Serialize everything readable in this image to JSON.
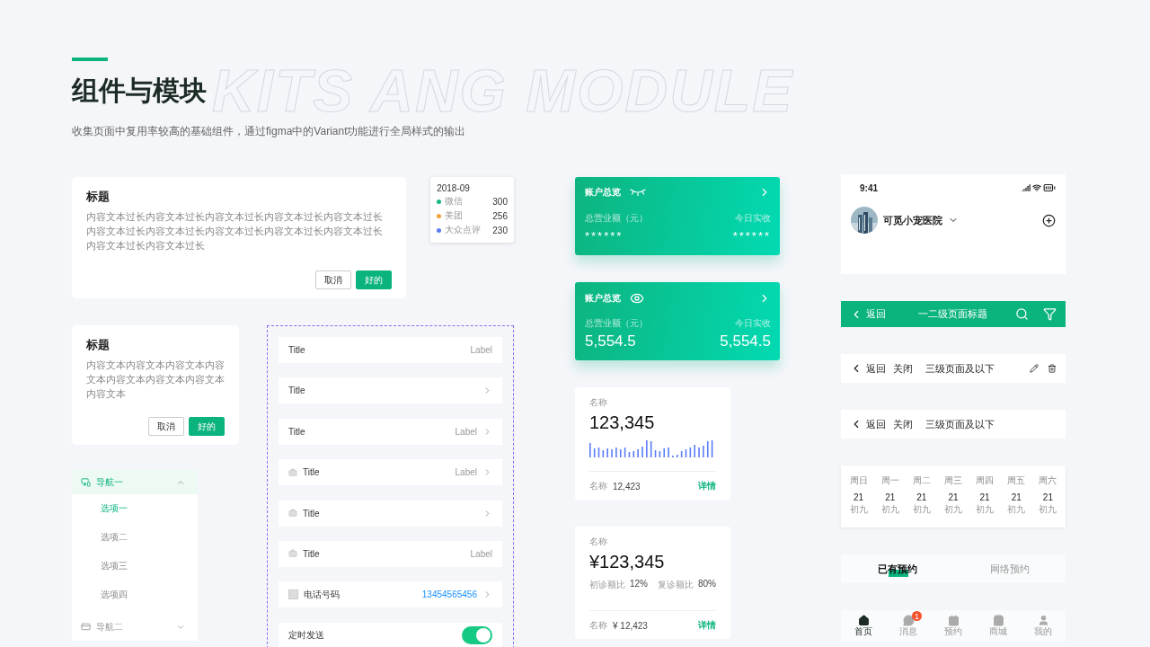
{
  "header": {
    "title": "组件与模块",
    "backdrop_text": "KITS ANG MODULE",
    "subtitle": "收集页面中复用率较高的基础组件，通过figma中的Variant功能进行全局样式的输出"
  },
  "dialogs": [
    {
      "title": "标题",
      "body": "内容文本过长内容文本过长内容文本过长内容文本过长内容文本过长内容文本过长内容文本过长内容文本过长内容文本过长内容文本过长内容文本过长内容文本过长",
      "buttons": [
        {
          "label": "取消",
          "kind": "secondary"
        },
        {
          "label": "好的",
          "kind": "primary"
        }
      ]
    },
    {
      "title": "标题",
      "body": "内容文本内容文本内容文本内容文本内容文本内容文本内容文本内容文本",
      "buttons": [
        {
          "label": "取消",
          "kind": "secondary"
        },
        {
          "label": "好的",
          "kind": "primary"
        }
      ]
    }
  ],
  "tooltip": {
    "date": "2018-09",
    "rows": [
      {
        "name": "微信",
        "value": "300",
        "color": "#12b886"
      },
      {
        "name": "美团",
        "value": "256",
        "color": "#f59f3a"
      },
      {
        "name": "大众点评",
        "value": "230",
        "color": "#5b7cf7"
      }
    ]
  },
  "nav_menu": [
    {
      "label": "导航一",
      "expanded": true,
      "items": [
        {
          "label": "选项一",
          "selected": true
        },
        {
          "label": "选项二",
          "selected": false
        },
        {
          "label": "选项三",
          "selected": false
        },
        {
          "label": "选项四",
          "selected": false
        }
      ]
    },
    {
      "label": "导航二",
      "expanded": false
    }
  ],
  "list_cells": [
    {
      "kind": "plain",
      "title": "Title",
      "label": "Label",
      "arrow": false
    },
    {
      "kind": "plain",
      "title": "Title",
      "arrow": true
    },
    {
      "kind": "plain",
      "title": "Title",
      "label": "Label",
      "arrow": true
    },
    {
      "kind": "icon",
      "title": "Title",
      "label": "Label",
      "arrow": true
    },
    {
      "kind": "icon",
      "title": "Title",
      "arrow": true
    },
    {
      "kind": "icon",
      "title": "Title",
      "label": "Label",
      "arrow": false
    },
    {
      "kind": "phone",
      "title": "电话号码",
      "value": "13454565456",
      "arrow": true
    },
    {
      "kind": "switch",
      "title": "定时发送",
      "on": true
    }
  ],
  "account_cards": [
    {
      "title": "账户总览",
      "hidden": true,
      "left_label": "总营业额（元）",
      "left_value": "******",
      "right_label": "今日实收",
      "right_value": "******"
    },
    {
      "title": "账户总览",
      "hidden": false,
      "left_label": "总营业额（元）",
      "left_value": "5,554.5",
      "right_label": "今日实收",
      "right_value": "5,554.5"
    }
  ],
  "stat_cards": [
    {
      "kind": "chart",
      "label": "名称",
      "value": "123,345",
      "footer_label": "名称",
      "footer_value": "12,423",
      "link": "详情"
    },
    {
      "kind": "ratio",
      "label": "名称",
      "value": "¥123,345",
      "ratios": [
        {
          "label": "初诊额比",
          "value": "12%"
        },
        {
          "label": "复诊额比",
          "value": "80%"
        }
      ],
      "footer_label": "名称",
      "footer_value": "¥ 12,423",
      "link": "详情"
    }
  ],
  "phone_header": {
    "time": "9:41",
    "org_name": "可觅小宠医院"
  },
  "nav_bars": [
    {
      "kind": "primary",
      "back": "返回",
      "title": "一二级页面标题"
    },
    {
      "kind": "secondary",
      "back": "返回",
      "close": "关闭",
      "title": "三级页面及以下",
      "actions": true
    },
    {
      "kind": "secondary",
      "back": "返回",
      "close": "关闭",
      "title": "三级页面及以下",
      "actions": false
    }
  ],
  "calendar": [
    {
      "weekday": "周日",
      "day": "21",
      "lunar": "初九"
    },
    {
      "weekday": "周一",
      "day": "21",
      "lunar": "初九"
    },
    {
      "weekday": "周二",
      "day": "21",
      "lunar": "初九"
    },
    {
      "weekday": "周三",
      "day": "21",
      "lunar": "初九"
    },
    {
      "weekday": "周四",
      "day": "21",
      "lunar": "初九"
    },
    {
      "weekday": "周五",
      "day": "21",
      "lunar": "初九"
    },
    {
      "weekday": "周六",
      "day": "21",
      "lunar": "初九"
    }
  ],
  "tabs": [
    {
      "label": "已有预约",
      "selected": true
    },
    {
      "label": "网络预约",
      "selected": false
    }
  ],
  "tab_bar": [
    {
      "label": "首页",
      "selected": true
    },
    {
      "label": "消息",
      "selected": false,
      "badge": "1"
    },
    {
      "label": "预约",
      "selected": false
    },
    {
      "label": "商城",
      "selected": false
    },
    {
      "label": "我的",
      "selected": false
    }
  ]
}
